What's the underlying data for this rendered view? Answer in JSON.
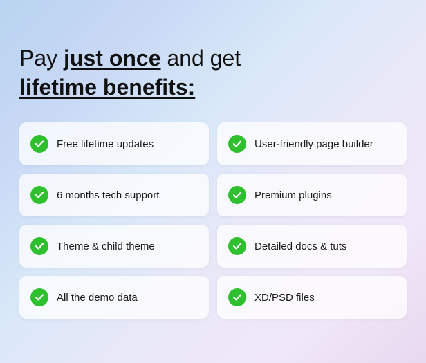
{
  "headline": {
    "prefix": "Pay ",
    "emphasis": "just once",
    "suffix": " and get",
    "line2": "lifetime benefits:"
  },
  "benefits": [
    {
      "id": "free-updates",
      "label": "Free lifetime updates"
    },
    {
      "id": "page-builder",
      "label": "User-friendly page builder"
    },
    {
      "id": "tech-support",
      "label": "6 months tech support"
    },
    {
      "id": "premium-plugins",
      "label": "Premium plugins"
    },
    {
      "id": "child-theme",
      "label": "Theme & child theme"
    },
    {
      "id": "docs-tuts",
      "label": "Detailed docs & tuts"
    },
    {
      "id": "demo-data",
      "label": "All the demo data"
    },
    {
      "id": "xd-psd",
      "label": "XD/PSD files"
    }
  ]
}
